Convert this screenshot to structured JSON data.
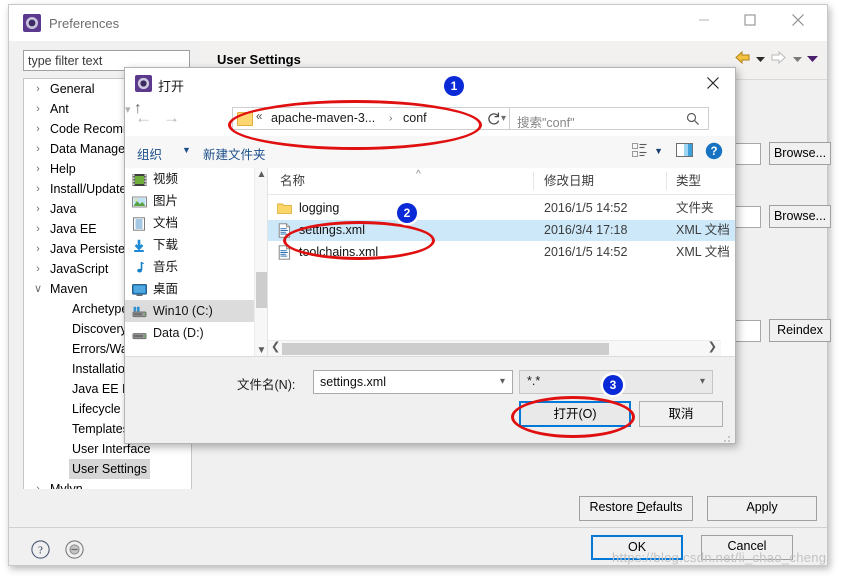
{
  "prefs_window": {
    "title": "Preferences",
    "icon": "eclipse-preferences-icon",
    "titlebar_buttons": {
      "minimize": "minimize-icon",
      "maximize": "maximize-icon",
      "close": "close-icon"
    },
    "filter": {
      "placeholder": "type filter text",
      "value": ""
    },
    "tree": [
      {
        "label": "General",
        "level": 1,
        "expanded": false,
        "selected": false
      },
      {
        "label": "Ant",
        "level": 1,
        "expanded": false,
        "selected": false
      },
      {
        "label": "Code Recomm",
        "level": 1,
        "expanded": false,
        "selected": false
      },
      {
        "label": "Data Manage",
        "level": 1,
        "expanded": false,
        "selected": false
      },
      {
        "label": "Help",
        "level": 1,
        "expanded": false,
        "selected": false
      },
      {
        "label": "Install/Update",
        "level": 1,
        "expanded": false,
        "selected": false
      },
      {
        "label": "Java",
        "level": 1,
        "expanded": false,
        "selected": false
      },
      {
        "label": "Java EE",
        "level": 1,
        "expanded": false,
        "selected": false
      },
      {
        "label": "Java Persisten",
        "level": 1,
        "expanded": false,
        "selected": false
      },
      {
        "label": "JavaScript",
        "level": 1,
        "expanded": false,
        "selected": false
      },
      {
        "label": "Maven",
        "level": 1,
        "expanded": true,
        "selected": false
      },
      {
        "label": "Archetype",
        "level": 2,
        "expanded": false,
        "selected": false
      },
      {
        "label": "Discovery",
        "level": 2,
        "expanded": false,
        "selected": false
      },
      {
        "label": "Errors/Wa",
        "level": 2,
        "expanded": false,
        "selected": false
      },
      {
        "label": "Installation",
        "level": 2,
        "expanded": false,
        "selected": false
      },
      {
        "label": "Java EE In",
        "level": 2,
        "expanded": false,
        "selected": false
      },
      {
        "label": "Lifecycle M",
        "level": 2,
        "expanded": false,
        "selected": false
      },
      {
        "label": "Templates",
        "level": 2,
        "expanded": false,
        "selected": false
      },
      {
        "label": "User Interface",
        "level": 2,
        "expanded": false,
        "selected": false
      },
      {
        "label": "User Settings",
        "level": 2,
        "expanded": false,
        "selected": true
      },
      {
        "label": "Mylyn",
        "level": 1,
        "expanded": false,
        "selected": false
      }
    ],
    "page": {
      "title": "User Settings",
      "browse_1": "Browse...",
      "browse_2": "Browse...",
      "reindex": "Reindex"
    },
    "footer": {
      "restore_defaults": "Restore Defaults",
      "apply": "Apply",
      "ok": "OK",
      "cancel": "Cancel",
      "help_icon": "help-icon",
      "menu_icon": "view-menu-icon"
    },
    "nav_toolbar": {
      "back_icon": "back-arrow-icon",
      "back_caret": "chevron-down-icon",
      "forward_icon": "forward-arrow-icon",
      "forward_caret": "chevron-down-icon",
      "menu_caret": "chevron-down-icon"
    }
  },
  "open_dialog": {
    "title": "打开",
    "icon": "eclipse-open-icon",
    "close_icon": "close-icon",
    "nav": {
      "back_icon": "back-arrow-icon",
      "forward_icon": "forward-arrow-icon",
      "recent_icon": "chevron-down-icon",
      "up_icon": "up-arrow-icon",
      "refresh_icon": "refresh-icon"
    },
    "address": {
      "folder_icon": "folder-icon",
      "chevron": "«",
      "segment1": "apache-maven-3...",
      "separator": "›",
      "segment2": "conf",
      "dropdown_icon": "chevron-down-icon"
    },
    "search": {
      "placeholder": "搜索\"conf\"",
      "icon": "search-icon",
      "value": ""
    },
    "toolbar": {
      "organize": "组织",
      "organize_caret": "▼",
      "new_folder": "新建文件夹",
      "view_icon": "list-view-icon",
      "view_caret": "▼",
      "preview_pane_icon": "preview-pane-icon",
      "help_icon": "help-icon"
    },
    "nav_pane": [
      {
        "label": "视频",
        "icon": "videos-icon",
        "selected": false
      },
      {
        "label": "图片",
        "icon": "pictures-icon",
        "selected": false
      },
      {
        "label": "文档",
        "icon": "documents-icon",
        "selected": false
      },
      {
        "label": "下载",
        "icon": "downloads-icon",
        "selected": false
      },
      {
        "label": "音乐",
        "icon": "music-icon",
        "selected": false
      },
      {
        "label": "桌面",
        "icon": "desktop-icon",
        "selected": false
      },
      {
        "label": "Win10 (C:)",
        "icon": "local-disk-icon",
        "selected": true
      },
      {
        "label": "Data (D:)",
        "icon": "local-disk-icon",
        "selected": false
      }
    ],
    "columns": [
      "名称",
      "修改日期",
      "类型"
    ],
    "files": [
      {
        "name": "logging",
        "date": "2016/1/5 14:52",
        "type": "文件夹",
        "icon": "folder-icon",
        "selected": false
      },
      {
        "name": "settings.xml",
        "date": "2016/3/4 17:18",
        "type": "XML 文档",
        "icon": "xml-file-icon",
        "selected": true
      },
      {
        "name": "toolchains.xml",
        "date": "2016/1/5 14:52",
        "type": "XML 文档",
        "icon": "xml-file-icon",
        "selected": false
      }
    ],
    "filename": {
      "label": "文件名(N):",
      "value": "settings.xml",
      "caret": "chevron-down-icon"
    },
    "filetype": {
      "value": "*.*",
      "caret": "chevron-down-icon"
    },
    "open_button": "打开(O)",
    "cancel_button": "取消"
  },
  "annotations": {
    "badges": [
      "1",
      "2",
      "3"
    ],
    "ellipse_color": "#e01010",
    "badge_color": "#0a2ad8"
  },
  "watermark": "https://blog.csdn.net/li_chao_cheng"
}
